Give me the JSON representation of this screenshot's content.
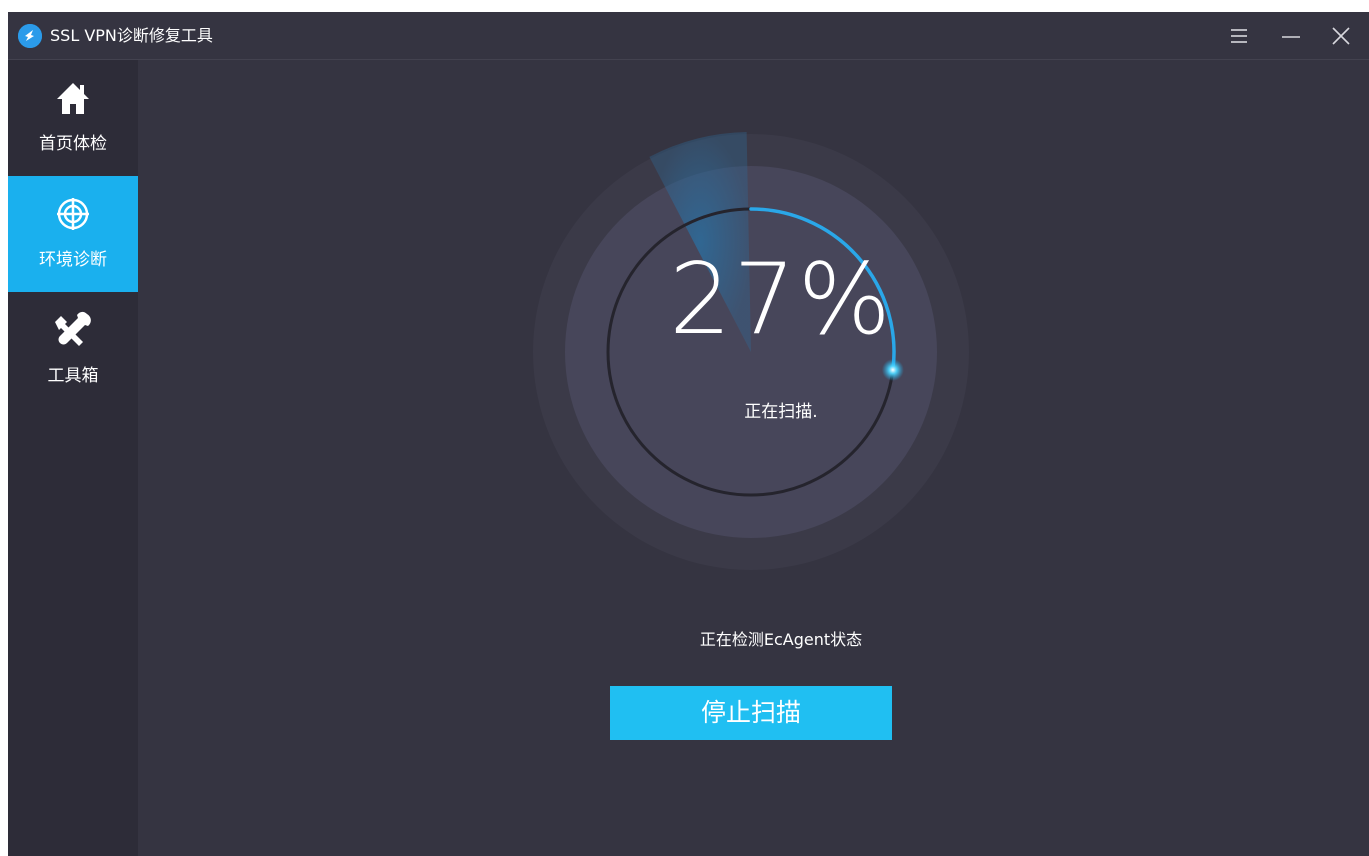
{
  "window": {
    "title": "SSL VPN诊断修复工具",
    "controls": [
      "menu-icon",
      "minimize-icon",
      "close-icon"
    ]
  },
  "sidebar": {
    "items": [
      {
        "label": "首页体检",
        "icon": "home-icon",
        "active": false
      },
      {
        "label": "环境诊断",
        "icon": "target-icon",
        "active": true
      },
      {
        "label": "工具箱",
        "icon": "tools-icon",
        "active": false
      }
    ]
  },
  "scan": {
    "percent_text": "27%",
    "progress": 0.27,
    "scan_label": "正在扫描.",
    "status": "正在检测EcAgent状态",
    "stop_label": "停止扫描"
  },
  "colors": {
    "background": "#353441",
    "sidebar": "#2d2c38",
    "accent": "#1ab0ee",
    "button": "#20bff2",
    "progress_arc": "#2aa7e8"
  }
}
